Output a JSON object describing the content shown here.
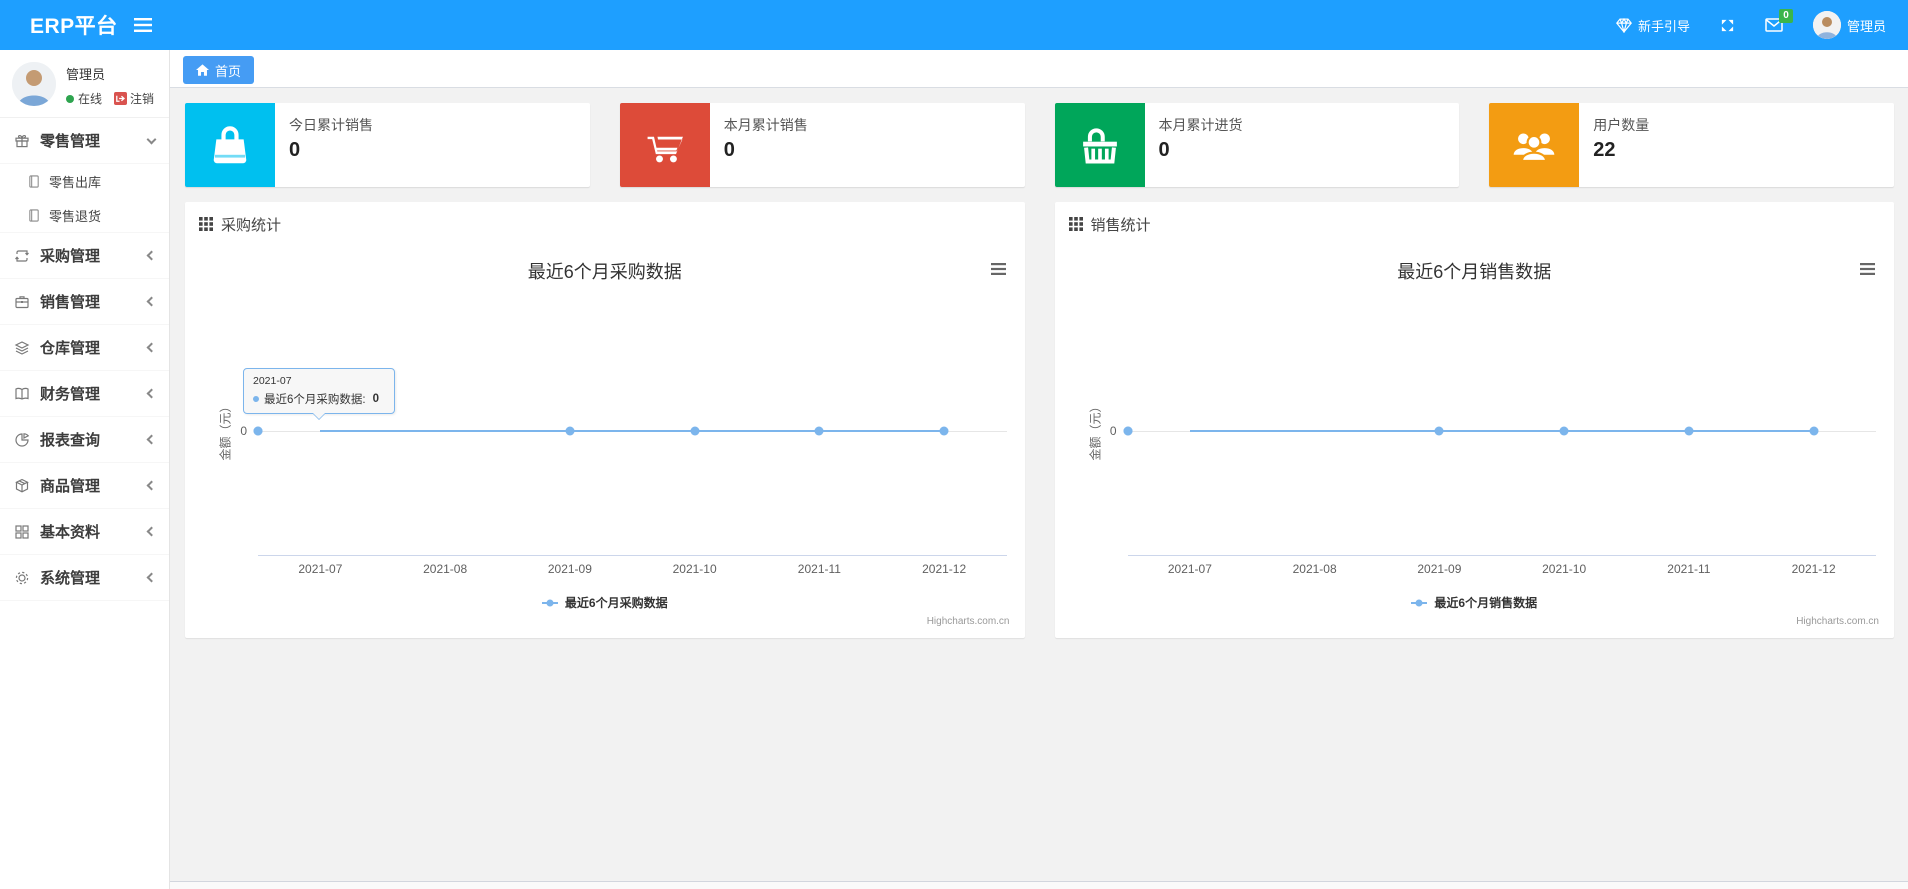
{
  "colors": {
    "navbar": "#1e9fff",
    "tab_active": "#459cf4",
    "chart_line": "#7cb5ec",
    "badge": "#3bb54a"
  },
  "navbar": {
    "brand": "ERP平台",
    "guide_label": "新手引导",
    "message_badge": "0",
    "user_name": "管理员"
  },
  "sidebar": {
    "user_name": "管理员",
    "status_label": "在线",
    "logout_label": "注销",
    "items": [
      {
        "label": "零售管理",
        "children": [
          "零售出库",
          "零售退货"
        ]
      },
      {
        "label": "采购管理"
      },
      {
        "label": "销售管理"
      },
      {
        "label": "仓库管理"
      },
      {
        "label": "财务管理"
      },
      {
        "label": "报表查询"
      },
      {
        "label": "商品管理"
      },
      {
        "label": "基本资料"
      },
      {
        "label": "系统管理"
      }
    ]
  },
  "tab_bar": {
    "home_label": "首页"
  },
  "stat_cards": [
    {
      "label": "今日累计销售",
      "value": "0",
      "color": "#00c0ef"
    },
    {
      "label": "本月累计销售",
      "value": "0",
      "color": "#dd4b39"
    },
    {
      "label": "本月累计进货",
      "value": "0",
      "color": "#00a65a"
    },
    {
      "label": "用户数量",
      "value": "22",
      "color": "#f39c12"
    }
  ],
  "panels": [
    {
      "header": "采购统计"
    },
    {
      "header": "销售统计"
    }
  ],
  "chart_data": [
    {
      "type": "line",
      "title": "最近6个月采购数据",
      "categories": [
        "2021-07",
        "2021-08",
        "2021-09",
        "2021-10",
        "2021-11",
        "2021-12"
      ],
      "series": [
        {
          "name": "最近6个月采购数据",
          "values": [
            0,
            0,
            0,
            0,
            0,
            0
          ],
          "color": "#7cb5ec"
        }
      ],
      "xlabel": "",
      "ylabel": "金额（元）",
      "yticks": [
        "0"
      ],
      "grid": true,
      "legend_position": "bottom",
      "credit": "Highcharts.com.cn",
      "tooltip": {
        "header": "2021-07",
        "series_label": "最近6个月采购数据:",
        "value": "0"
      }
    },
    {
      "type": "line",
      "title": "最近6个月销售数据",
      "categories": [
        "2021-07",
        "2021-08",
        "2021-09",
        "2021-10",
        "2021-11",
        "2021-12"
      ],
      "series": [
        {
          "name": "最近6个月销售数据",
          "values": [
            0,
            0,
            0,
            0,
            0,
            0
          ],
          "color": "#7cb5ec"
        }
      ],
      "xlabel": "",
      "ylabel": "金额（元）",
      "yticks": [
        "0"
      ],
      "grid": true,
      "legend_position": "bottom",
      "credit": "Highcharts.com.cn"
    }
  ]
}
